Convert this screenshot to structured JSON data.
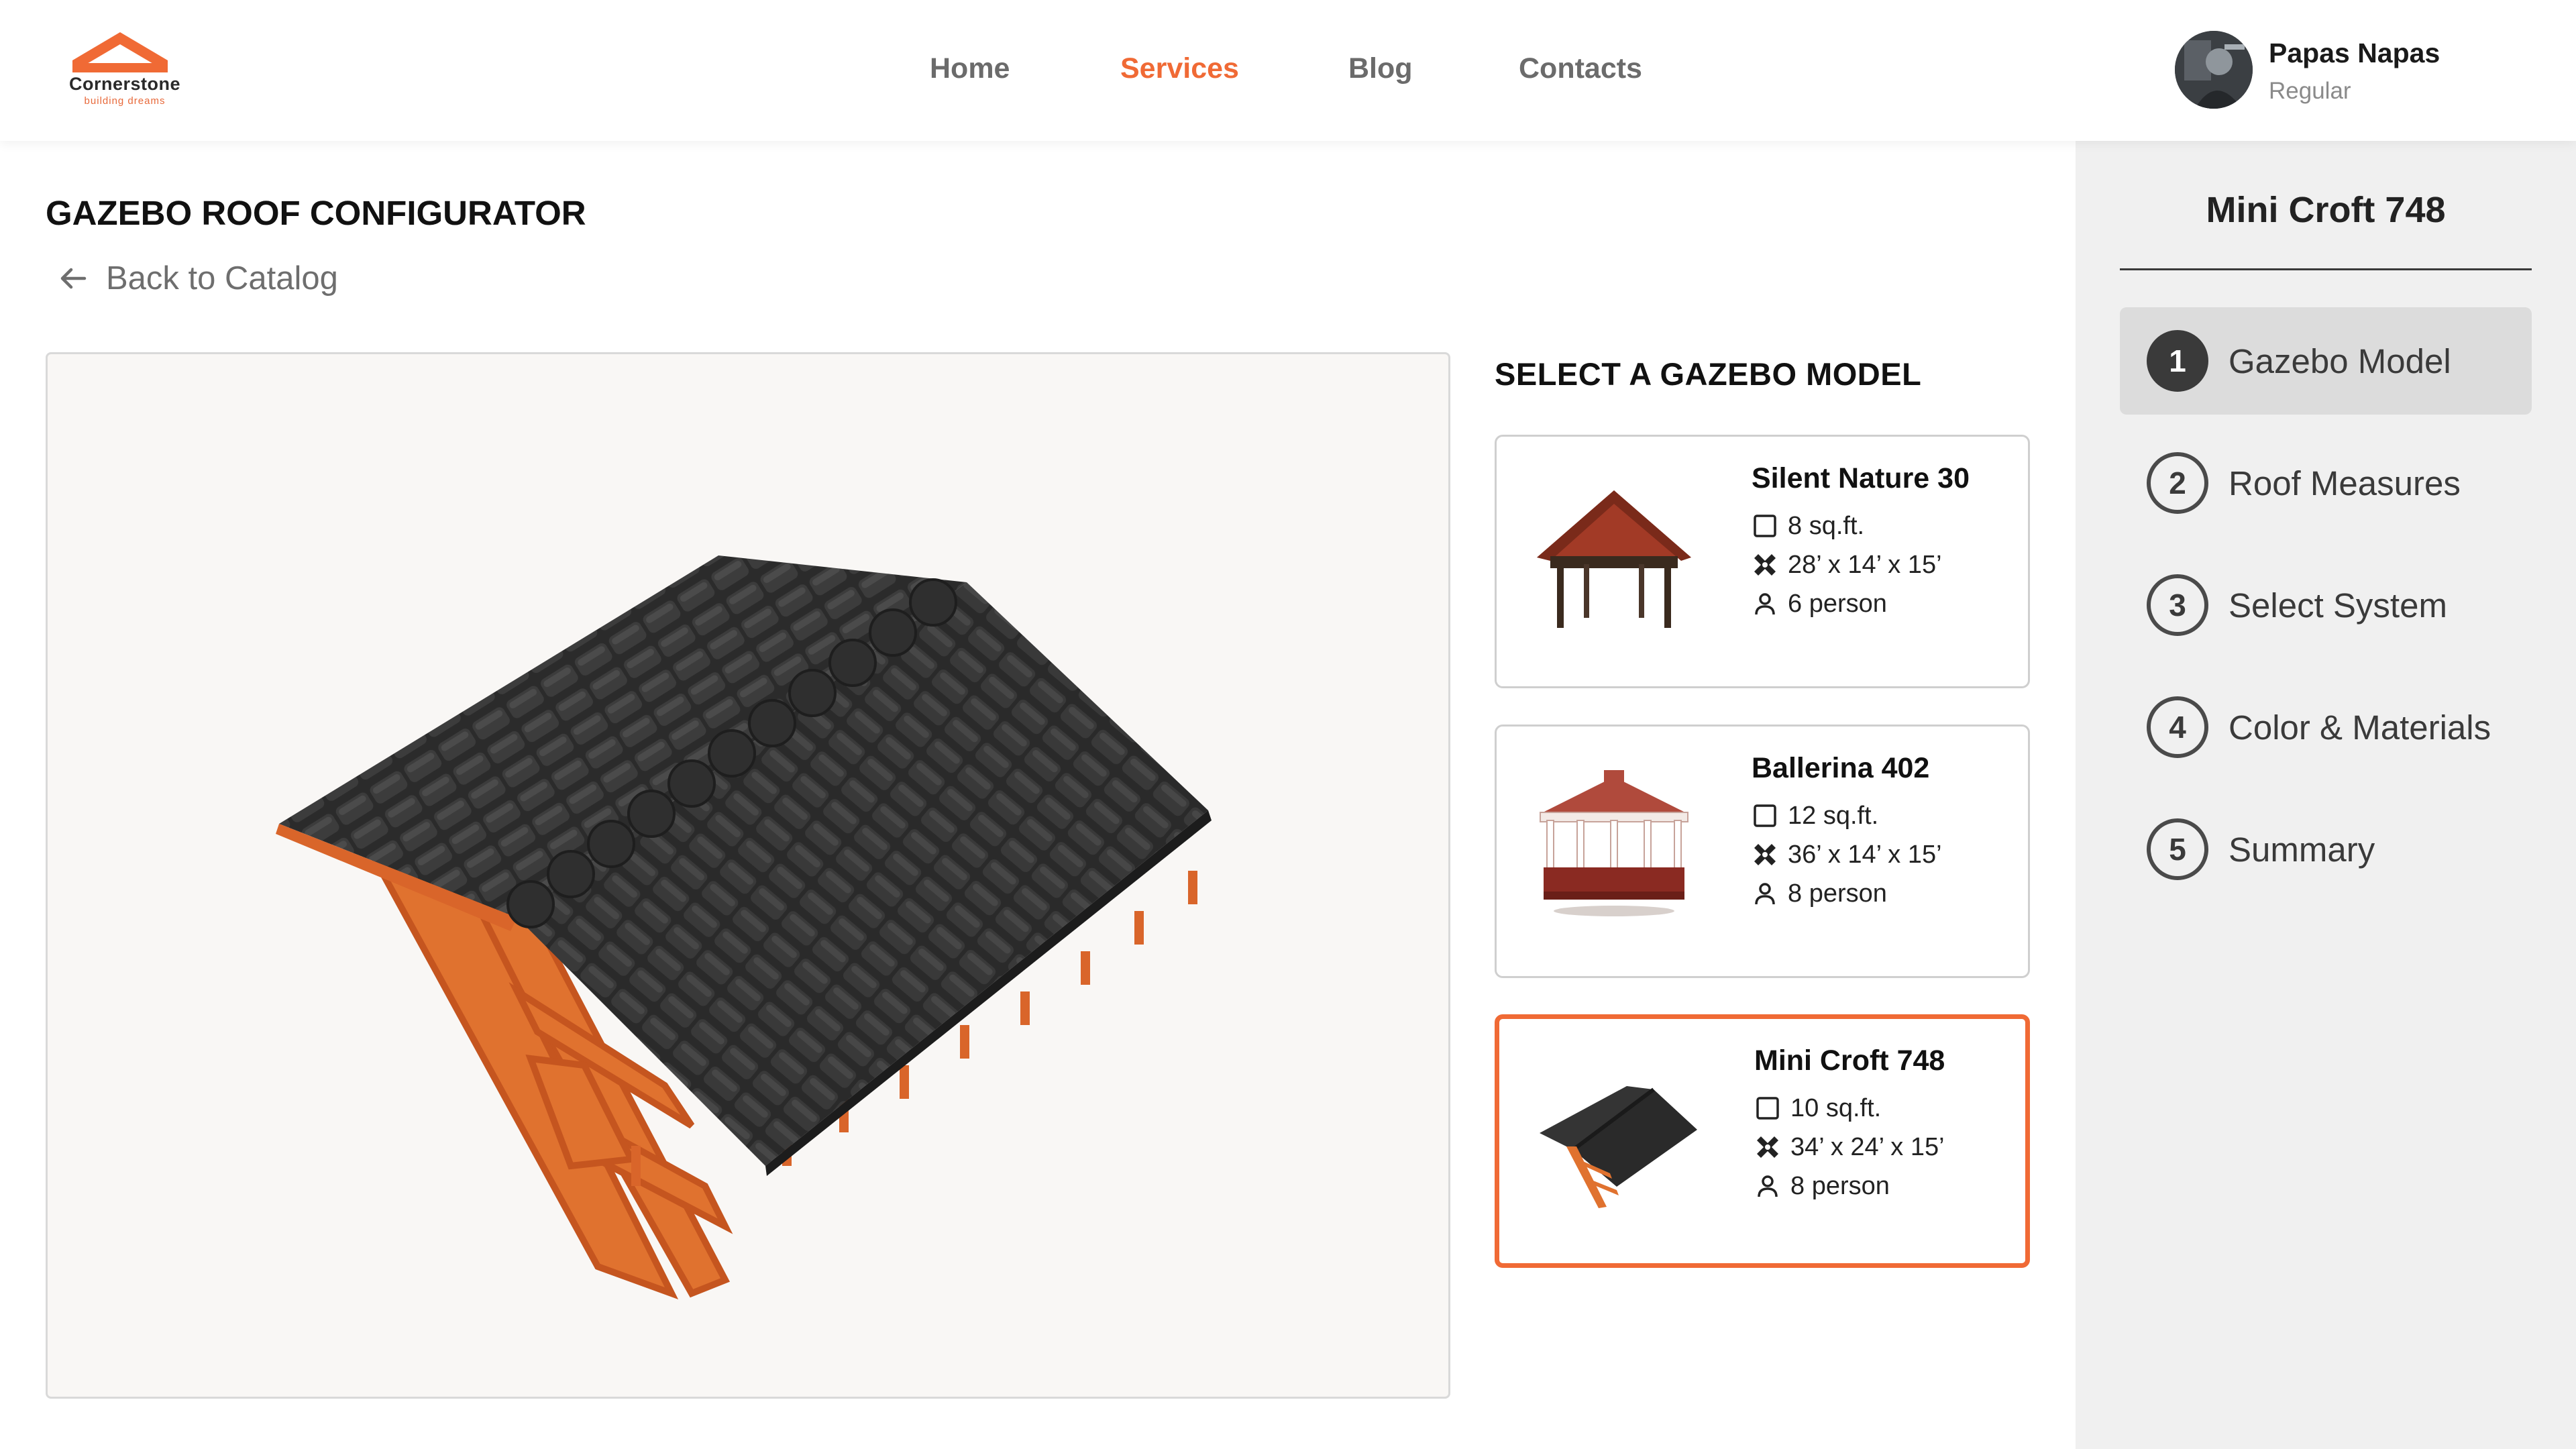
{
  "brand": {
    "name": "Cornerstone",
    "tagline": "building dreams",
    "accent": "#f06a35"
  },
  "nav": {
    "items": [
      "Home",
      "Services",
      "Blog",
      "Contacts"
    ],
    "active": "Services"
  },
  "user": {
    "name": "Papas Napas",
    "role": "Regular"
  },
  "page": {
    "title": "GAZEBO ROOF CONFIGURATOR",
    "back_label": "Back to Catalog"
  },
  "models": {
    "heading": "SELECT A GAZEBO MODEL",
    "items": [
      {
        "name": "Silent Nature 30",
        "area": "8 sq.ft.",
        "dimensions": "28’ x 14’ x 15’",
        "capacity": "6 person",
        "selected": false
      },
      {
        "name": "Ballerina 402",
        "area": "12 sq.ft.",
        "dimensions": "36’ x 14’ x 15’",
        "capacity": "8 person",
        "selected": false
      },
      {
        "name": "Mini Croft 748",
        "area": "10 sq.ft.",
        "dimensions": "34’ x 24’ x 15’",
        "capacity": "8 person",
        "selected": true
      }
    ]
  },
  "sidebar": {
    "title": "Mini Croft 748",
    "steps": [
      {
        "number": "1",
        "label": "Gazebo Model",
        "active": true
      },
      {
        "number": "2",
        "label": "Roof Measures",
        "active": false
      },
      {
        "number": "3",
        "label": "Select System",
        "active": false
      },
      {
        "number": "4",
        "label": "Color & Materials",
        "active": false
      },
      {
        "number": "5",
        "label": "Summary",
        "active": false
      }
    ]
  },
  "icons": {
    "back": "arrow-left-icon",
    "area": "square-icon",
    "dimensions": "ruler-pencil-icon",
    "capacity": "person-icon"
  }
}
